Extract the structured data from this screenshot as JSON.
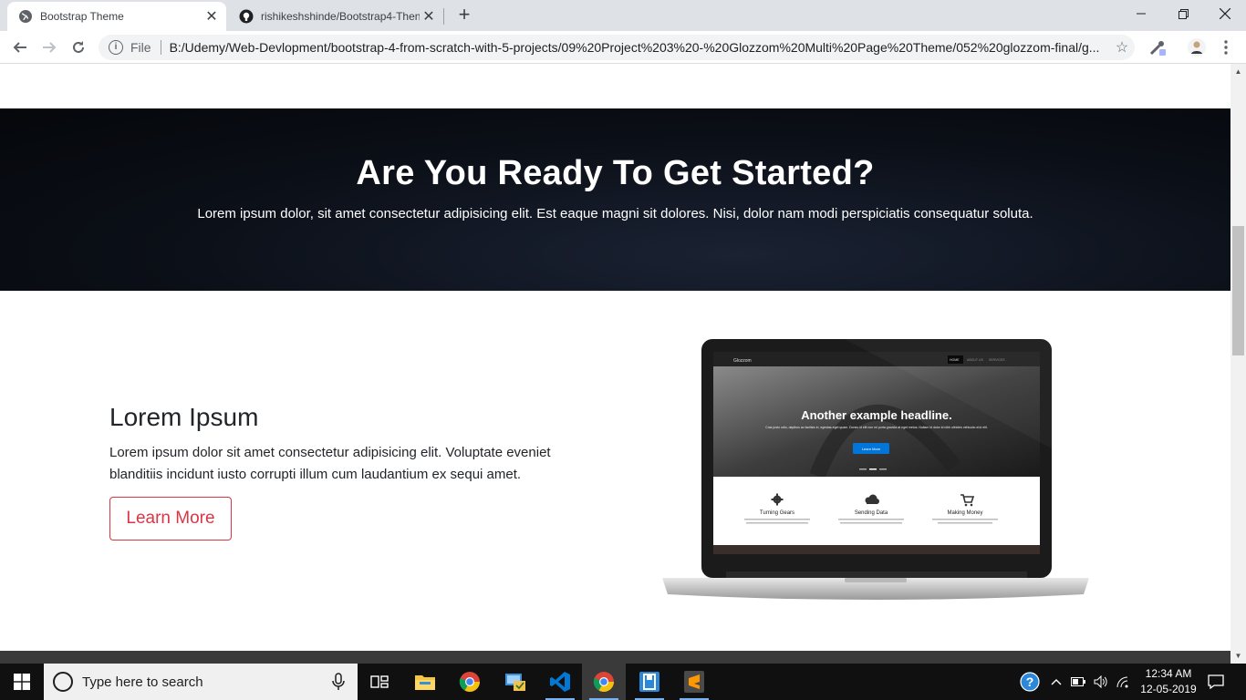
{
  "browser": {
    "tabs": [
      {
        "title": "Bootstrap Theme",
        "icon": "globe-icon",
        "active": true
      },
      {
        "title": "rishikeshshinde/Bootstrap4-Then",
        "icon": "github-icon",
        "active": false
      }
    ],
    "new_tab_label": "+",
    "address": {
      "scheme_label": "File",
      "url": "B:/Udemy/Web-Devlopment/bootstrap-4-from-scratch-with-5-projects/09%20Project%203%20-%20Glozzom%20Multi%20Page%20Theme/052%20glozzom-final/g..."
    }
  },
  "page": {
    "cta": {
      "heading": "Are You Ready To Get Started?",
      "text": "Lorem ipsum dolor, sit amet consectetur adipisicing elit. Est eaque magni sit dolores. Nisi, dolor nam modi perspiciatis consequatur soluta."
    },
    "feature": {
      "heading": "Lorem Ipsum",
      "text": "Lorem ipsum dolor sit amet consectetur adipisicing elit. Voluptate eveniet blanditiis incidunt iusto corrupti illum cum laudantium ex sequi amet.",
      "button_label": "Learn More"
    },
    "laptop_screen": {
      "brand": "Glozzom",
      "nav": [
        "HOME",
        "ABOUT US",
        "SERVICES"
      ],
      "headline": "Another example headline.",
      "subtext": "Cras justo odio, dapibus ac facilisis in, egestas eget quam. Donec id elit non mi porta gravida at eget metus. Nullam id dolor id nibh ultricies vehicula ut id elit.",
      "button": "Learn More",
      "features": [
        {
          "title": "Turning Gears",
          "icon": "gear-icon",
          "text": "Lorem ipsum dolor sit amet, consectetur adipiscing elit. Aperiam magni doloribus"
        },
        {
          "title": "Sending Data",
          "icon": "cloud-icon",
          "text": "Velit, soluta optio, ad iusto eveniet quae hic voluptas neque doloribus inventore."
        },
        {
          "title": "Making Money",
          "icon": "cart-icon",
          "text": "Voluptate recusandae numquam accusantium molestias ipsam, atque"
        }
      ]
    }
  },
  "taskbar": {
    "search_placeholder": "Type here to search",
    "clock": {
      "time": "12:34 AM",
      "date": "12-05-2019"
    }
  }
}
